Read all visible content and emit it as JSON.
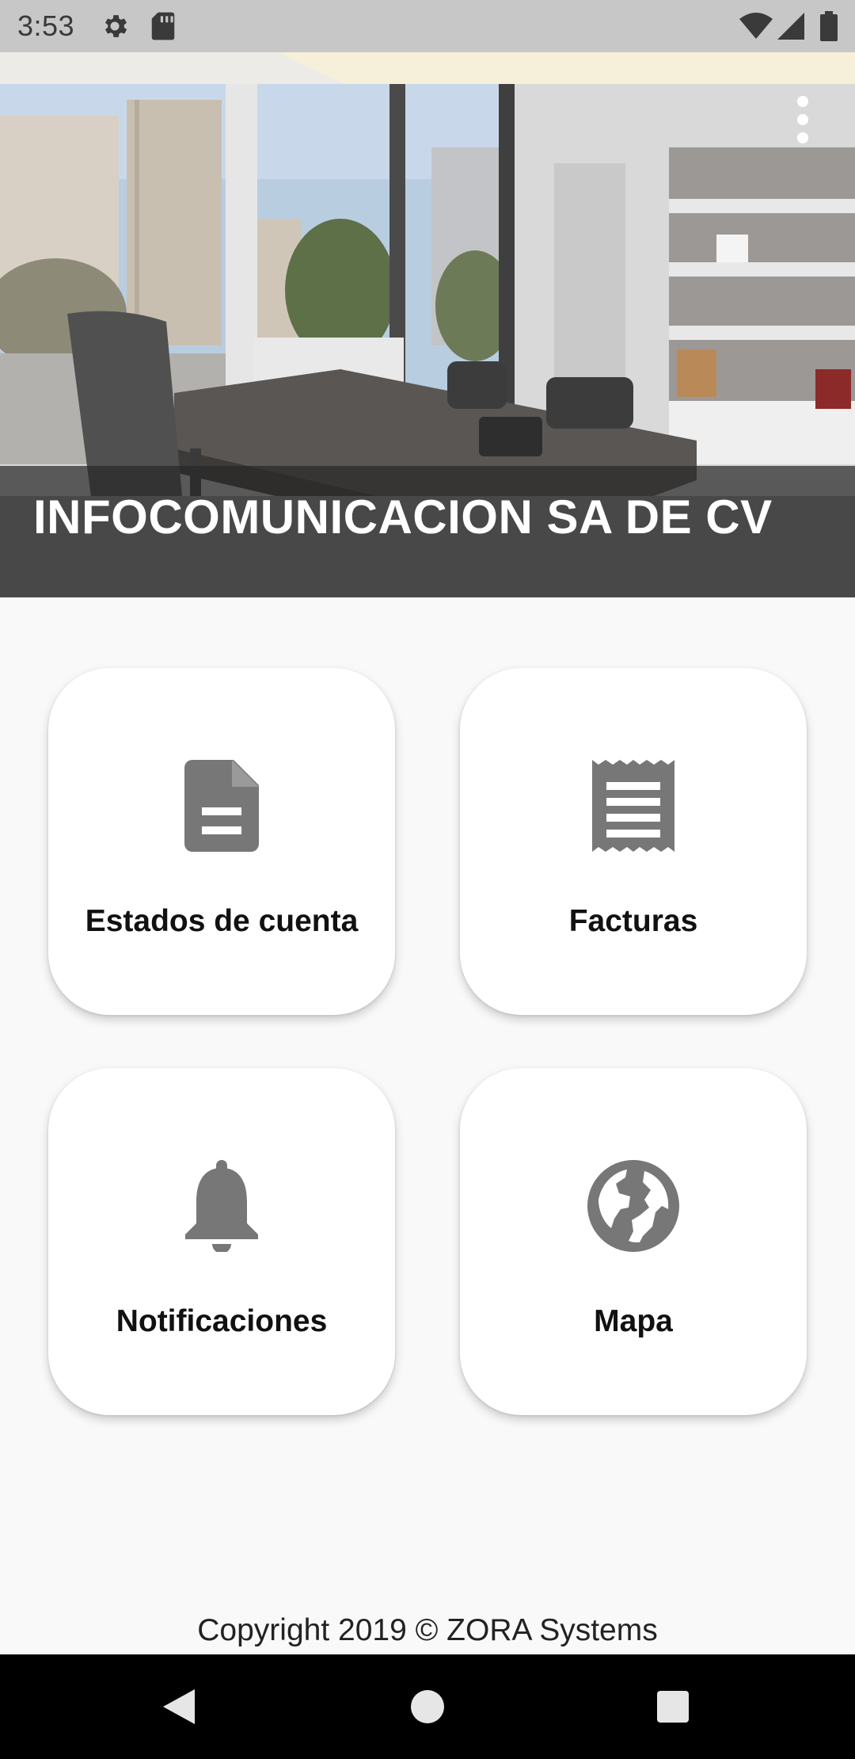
{
  "status_bar": {
    "time": "3:53",
    "left_icons": [
      "gear-icon",
      "sd-card-icon"
    ],
    "right_icons": [
      "wifi-icon",
      "signal-icon",
      "battery-icon"
    ],
    "background": "#c7c7c7"
  },
  "header": {
    "company_name": "INFOCOMUNICACION SA DE CV",
    "menu_icon": "more-vert-icon"
  },
  "menu": {
    "items": [
      {
        "id": "estados",
        "label": "Estados de cuenta",
        "icon": "document-icon"
      },
      {
        "id": "facturas",
        "label": "Facturas",
        "icon": "receipt-icon"
      },
      {
        "id": "notificaciones",
        "label": "Notificaciones",
        "icon": "bell-icon"
      },
      {
        "id": "mapa",
        "label": "Mapa",
        "icon": "globe-icon"
      }
    ],
    "icon_color": "#777777"
  },
  "footer": {
    "copyright": "Copyright 2019 © ZORA Systems"
  },
  "nav_bar": {
    "buttons": [
      "back-icon",
      "home-icon",
      "recents-icon"
    ]
  }
}
